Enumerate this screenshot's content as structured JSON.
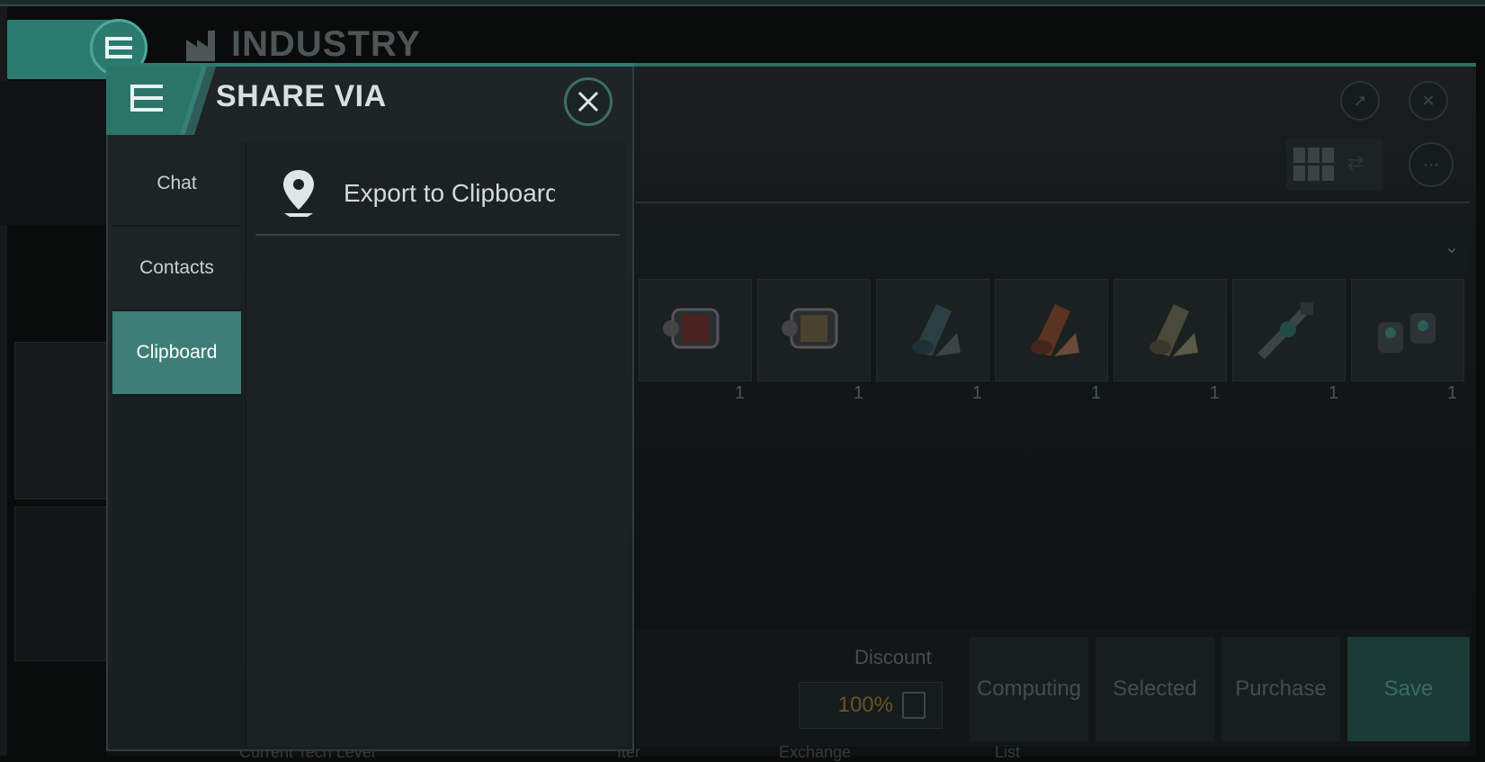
{
  "background": {
    "title": "INDUSTRY",
    "slots": [
      {
        "qty": "1"
      },
      {
        "qty": "1"
      },
      {
        "qty": "1"
      },
      {
        "qty": "1"
      },
      {
        "qty": "1"
      },
      {
        "qty": "1"
      },
      {
        "qty": "1"
      }
    ],
    "discount_label": "Discount",
    "discount_value": "100%",
    "actions": {
      "computing": "Computing",
      "selected": "Selected",
      "purchase": "Purchase",
      "save": "Save"
    },
    "footer": {
      "tech_level": "Current Tech Level",
      "col_a": "Iter",
      "col_b": "Exchange",
      "col_c": "List"
    }
  },
  "share_panel": {
    "title": "SHARE VIA",
    "nav": [
      {
        "label": "Chat"
      },
      {
        "label": "Contacts"
      },
      {
        "label": "Clipboard",
        "active": true
      }
    ],
    "export_label": "Export to Clipboard"
  },
  "colors": {
    "accent": "#2c7b71",
    "active_nav": "#3d7f76",
    "discount": "#6a5522"
  }
}
